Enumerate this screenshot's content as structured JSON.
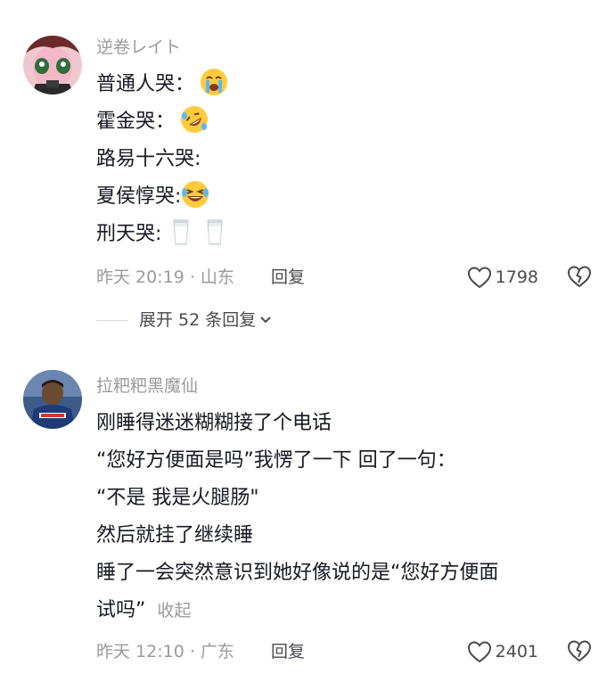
{
  "comments": [
    {
      "username": "逆卷レイト",
      "lines": [
        "普通人哭：",
        "霍金哭：",
        "路易十六哭:",
        "夏侯惇哭:",
        "刑天哭:"
      ],
      "emojis": [
        "loudly-crying-face",
        "rolling-on-floor-laughing-face",
        "",
        "grinning-squinting-sweat-face",
        "milk-glass"
      ],
      "date": "昨天 20:19 · 山东",
      "reply": "回复",
      "likes": "1798",
      "expand": "展开 52 条回复"
    },
    {
      "username": "拉粑粑黑魔仙",
      "lines": [
        "刚睡得迷迷糊糊接了个电话",
        "“您好方便面是吗”我愣了一下 回了一句：",
        "“不是 我是火腿肠\"",
        "然后就挂了继续睡",
        "睡了一会突然意识到她好像说的是“您好方便面",
        "试吗”"
      ],
      "collapse": "收起",
      "date": "昨天 12:10 · 广东",
      "reply": "回复",
      "likes": "2401"
    }
  ]
}
